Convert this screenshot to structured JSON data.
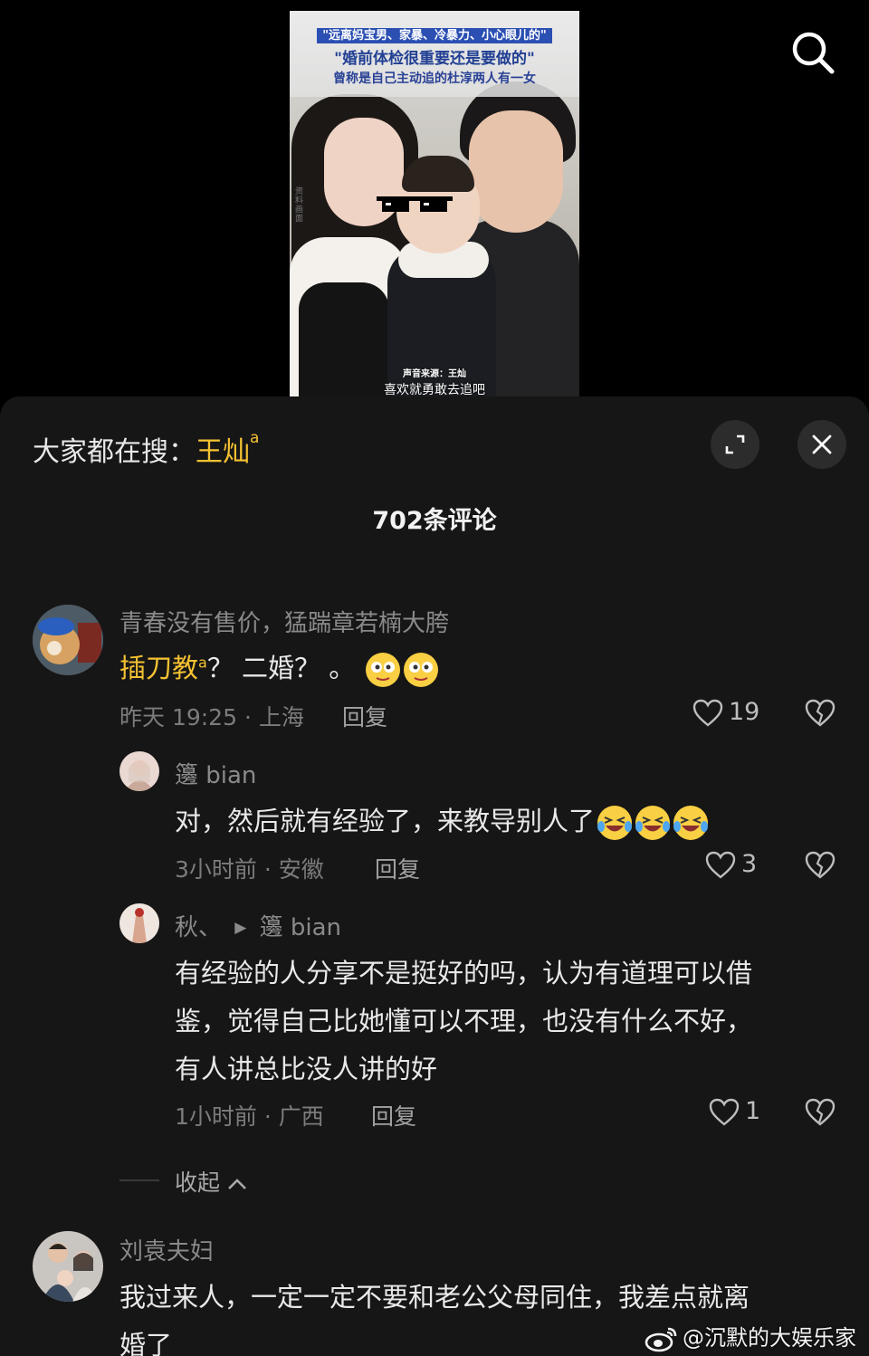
{
  "video": {
    "caption_line1": "\"远离妈宝男、家暴、冷暴力、小心眼儿的\"",
    "caption_line2": "\"婚前体检很重要还是要做的\"",
    "caption_line3": "曾称是自己主动追的杜淳两人有一女",
    "side_text": "资料画面",
    "sound_source": "声音来源：王灿",
    "subtitle": "喜欢就勇敢去追吧"
  },
  "panel": {
    "hot_search_prefix": "大家都在搜：",
    "hot_search_term": "王灿",
    "comment_count": "702条评论"
  },
  "comments": [
    {
      "username": "青春没有售价，猛踹章若楠大胯",
      "text_link": "插刀教",
      "text_rest": "？ 二婚？ 。",
      "time": "昨天 19:25 · 上海",
      "reply": "回复",
      "likes": "19"
    },
    {
      "username": "籩 bian",
      "text": "对，然后就有经验了，来教导别人了",
      "time": "3小时前 · 安徽",
      "reply": "回复",
      "likes": "3"
    },
    {
      "username": "秋、",
      "reply_to": "籩 bian",
      "text_lines": [
        "有经验的人分享不是挺好的吗，认为有道理可以借",
        "鉴，觉得自己比她懂可以不理，也没有什么不好，",
        "有人讲总比没人讲的好"
      ],
      "time": "1小时前 · 广西",
      "reply": "回复",
      "likes": "1"
    },
    {
      "username": "刘袁夫妇",
      "text_lines": [
        "我过来人，一定一定不要和老公父母同住，我差点就离",
        "婚了"
      ]
    }
  ],
  "collapse_label": "收起",
  "watermark": "@沉默的大娱乐家",
  "colors": {
    "accent": "#f5c232",
    "panel_bg": "#161616",
    "bg": "#000000"
  },
  "icons": [
    "search-icon",
    "expand-icon",
    "close-icon",
    "heart-icon",
    "broken-heart-icon",
    "chevron-up-icon",
    "play-arrow-icon",
    "weibo-icon"
  ]
}
